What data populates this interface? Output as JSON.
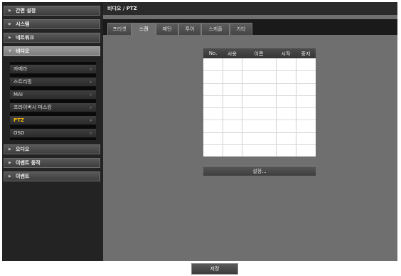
{
  "sidebar": {
    "top_items": [
      {
        "label": "간편 설정",
        "arrow": "▶"
      },
      {
        "label": "시스템",
        "arrow": "▶"
      },
      {
        "label": "네트워크",
        "arrow": "▶"
      },
      {
        "label": "비디오",
        "arrow": "▼"
      },
      {
        "label": "오디오",
        "arrow": "▶"
      },
      {
        "label": "이벤트 동작",
        "arrow": "▶"
      },
      {
        "label": "이벤트",
        "arrow": "▶"
      }
    ],
    "video_sub_items": [
      {
        "label": "카메라",
        "chevron": "›"
      },
      {
        "label": "스트리밍",
        "chevron": "›"
      },
      {
        "label": "MAI",
        "chevron": "›"
      },
      {
        "label": "프라이버시 마스킹",
        "chevron": "›"
      },
      {
        "label": "PTZ",
        "chevron": "›"
      },
      {
        "label": "OSD",
        "chevron": "›"
      }
    ]
  },
  "header": {
    "breadcrumb": "비디오 / PTZ"
  },
  "tabs": [
    "프리셋",
    "스캔",
    "패턴",
    "투어",
    "스케줄",
    "기타"
  ],
  "scan_table": {
    "columns": [
      "No.",
      "사용",
      "이름",
      "시작",
      "중지"
    ],
    "rows": 8
  },
  "buttons": {
    "setup": "설정...",
    "save": "저장"
  },
  "colors": {
    "selected_text": "#f5b400",
    "panel_bg": "#6f6f6f"
  }
}
